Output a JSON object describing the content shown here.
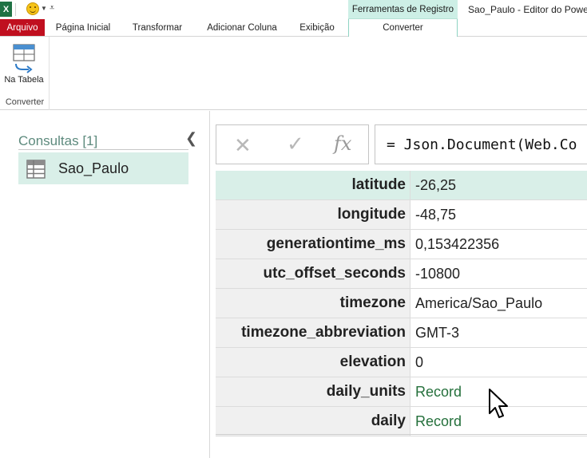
{
  "titlebar": {
    "app_icon": "X",
    "context_tab_header": "Ferramentas de Registro",
    "window_title": "Sao_Paulo - Editor do Power"
  },
  "tabs": [
    {
      "label": "Arquivo"
    },
    {
      "label": "Página Inicial"
    },
    {
      "label": "Transformar"
    },
    {
      "label": "Adicionar Coluna"
    },
    {
      "label": "Exibição"
    },
    {
      "label": "Converter"
    }
  ],
  "ribbon": {
    "to_table_label": "Na Tabela",
    "group_label": "Converter"
  },
  "queries_pane": {
    "title": "Consultas [1]",
    "items": [
      {
        "label": "Sao_Paulo"
      }
    ]
  },
  "formula_bar": {
    "formula": "= Json.Document(Web.Co"
  },
  "record": {
    "rows": [
      {
        "key": "latitude",
        "value": "-26,25"
      },
      {
        "key": "longitude",
        "value": "-48,75"
      },
      {
        "key": "generationtime_ms",
        "value": "0,153422356"
      },
      {
        "key": "utc_offset_seconds",
        "value": "-10800"
      },
      {
        "key": "timezone",
        "value": "America/Sao_Paulo"
      },
      {
        "key": "timezone_abbreviation",
        "value": "GMT-3"
      },
      {
        "key": "elevation",
        "value": "0"
      },
      {
        "key": "daily_units",
        "value": "Record"
      },
      {
        "key": "daily",
        "value": "Record"
      }
    ]
  },
  "colors": {
    "file_tab": "#c00f1f",
    "context_tab": "#cdefe6",
    "selection": "#d9efe8",
    "record_link": "#25703c"
  },
  "icons": [
    "excel-logo-icon",
    "smiley-icon",
    "to-table-icon",
    "collapse-chevron-icon",
    "table-icon",
    "cancel-icon",
    "commit-icon",
    "fx-icon",
    "mouse-cursor-icon"
  ]
}
